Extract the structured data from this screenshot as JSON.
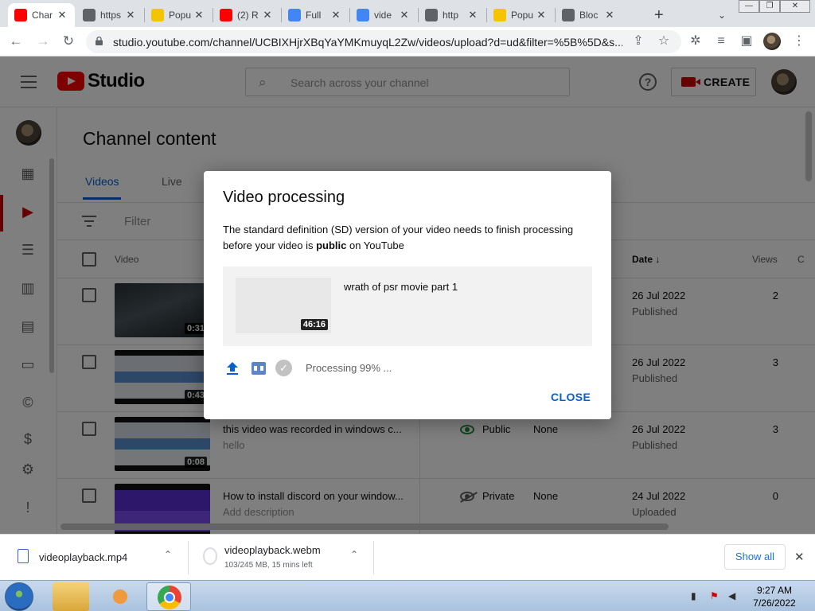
{
  "browser": {
    "tabs": [
      {
        "title": "Char",
        "favicon": "youtube-red",
        "color": "#ff0000",
        "active": true
      },
      {
        "title": "https",
        "favicon": "globe",
        "color": "#5f6368"
      },
      {
        "title": "Popu",
        "favicon": "honey",
        "color": "#f5c400"
      },
      {
        "title": "(2) R",
        "favicon": "youtube-red",
        "color": "#ff0000"
      },
      {
        "title": "Full",
        "favicon": "colorful",
        "color": "#4285f4"
      },
      {
        "title": "vide",
        "favicon": "google-g",
        "color": "#4285f4"
      },
      {
        "title": "http",
        "favicon": "globe",
        "color": "#5f6368"
      },
      {
        "title": "Popu",
        "favicon": "honey",
        "color": "#f5c400"
      },
      {
        "title": "Bloc",
        "favicon": "globe",
        "color": "#5f6368"
      }
    ],
    "new_tab_label": "+",
    "url": "studio.youtube.com/channel/UCBIXHjrXBqYaYMKmuyqL2Zw/videos/upload?d=ud&filter=%5B%5D&s..."
  },
  "studio": {
    "logo_text": "Studio",
    "search_placeholder": "Search across your channel",
    "create_label": "CREATE",
    "help_label": "?"
  },
  "content": {
    "page_title": "Channel content",
    "tabs": [
      "Videos",
      "Live"
    ],
    "filter_placeholder": "Filter",
    "columns": {
      "video": "Video",
      "date": "Date",
      "date_sort": "↓",
      "views": "Views",
      "comments": "C"
    },
    "rows": [
      {
        "duration": "0:31",
        "title": "",
        "desc": "",
        "visibility": "",
        "restrictions": "",
        "date": "26 Jul 2022",
        "status": "Published",
        "views": "2",
        "thumb": "night"
      },
      {
        "duration": "0:43",
        "title": "",
        "desc": "",
        "visibility": "",
        "restrictions": "",
        "date": "26 Jul 2022",
        "status": "Published",
        "views": "3",
        "thumb": "screen"
      },
      {
        "duration": "0:08",
        "title": "this video was recorded in windows c...",
        "desc": "hello",
        "visibility": "Public",
        "restrictions": "None",
        "date": "26 Jul 2022",
        "status": "Published",
        "views": "3",
        "thumb": "screen"
      },
      {
        "duration": "",
        "title": "How to install discord on your window...",
        "desc": "Add description",
        "visibility": "Private",
        "restrictions": "None",
        "date": "24 Jul 2022",
        "status": "Uploaded",
        "views": "0",
        "thumb": "purple"
      }
    ]
  },
  "dialog": {
    "title": "Video processing",
    "body_prefix": "The standard definition (SD) version of your video needs to finish processing before your video is ",
    "body_bold": "public",
    "body_suffix": " on YouTube",
    "video_title": "wrath of psr movie part 1",
    "video_duration": "46:16",
    "processing_text": "Processing 99% ...",
    "processing_progress": 0.99,
    "close_label": "CLOSE"
  },
  "downloads": {
    "items": [
      {
        "name": "videoplayback.mp4",
        "detail": ""
      },
      {
        "name": "videoplayback.webm",
        "detail": "103/245 MB, 15 mins left"
      }
    ],
    "show_all": "Show all",
    "close_label": "✕"
  },
  "taskbar": {
    "time": "9:27 AM",
    "date": "7/26/2022"
  },
  "colors": {
    "youtube_red": "#ff0000",
    "link_blue": "#065fd4",
    "public_green": "#2b8a3e"
  }
}
